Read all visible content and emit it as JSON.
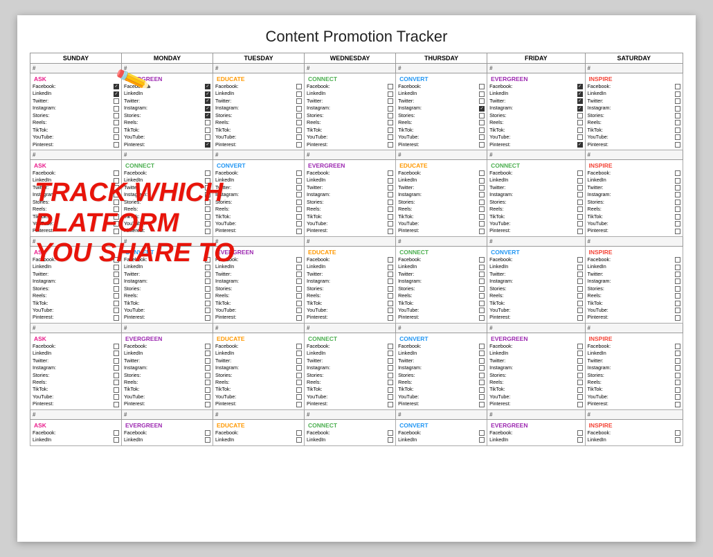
{
  "title": "Content Promotion Tracker",
  "days": [
    "SUNDAY",
    "MONDAY",
    "TUESDAY",
    "WEDNESDAY",
    "THURSDAY",
    "FRIDAY",
    "SATURDAY"
  ],
  "platforms": [
    "Facebook:",
    "LinkedIn",
    "Twitter:",
    "Instagram:",
    "Stories:",
    "Reels:",
    "TikTok:",
    "YouTube:",
    "Pinterest:"
  ],
  "categories": {
    "ask": "ASK",
    "educate": "EDUCATE",
    "connect": "CONNECT",
    "convert": "CONVERT",
    "evergreen": "EVERGREEN",
    "inspire": "INSPIRE"
  },
  "overlay": {
    "line1": "TRACK WHICH",
    "line2": "PLATFORM",
    "line3": "YOU SHARE TO"
  },
  "hash_label": "#",
  "rows": [
    [
      "ASK",
      "EVERGREEN",
      "EDUCATE",
      "CONNECT",
      "CONVERT",
      "EVERGREEN",
      "INSPIRE"
    ],
    [
      "ASK",
      "CONNECT",
      "CONVERT",
      "EVERGREEN",
      "EDUCATE",
      "CONNECT",
      "INSPIRE"
    ],
    [
      "ASK",
      "CONVERT",
      "EVERGREEN",
      "EDUCATE",
      "CONNECT",
      "CONVERT",
      "INSPIRE"
    ],
    [
      "ASK",
      "EVERGREEN",
      "EDUCATE",
      "CONNECT",
      "CONVERT",
      "EVERGREEN",
      "INSPIRE"
    ]
  ]
}
